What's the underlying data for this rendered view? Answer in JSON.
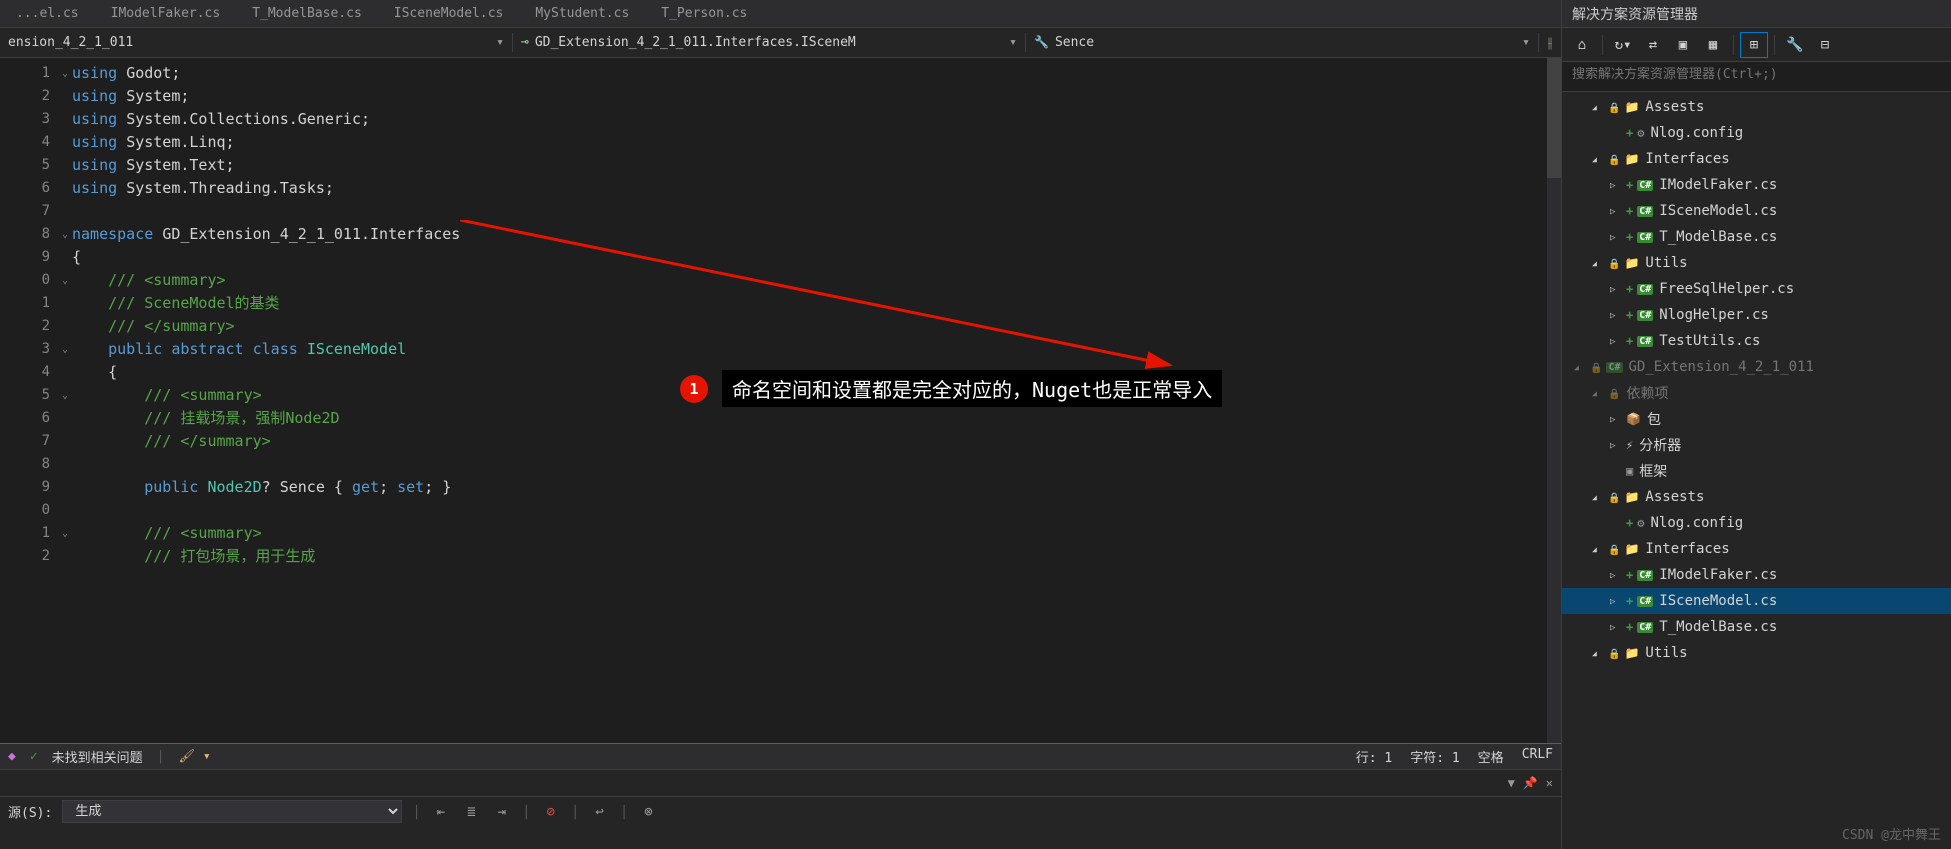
{
  "tabs": [
    {
      "label": "...el.cs"
    },
    {
      "label": "IModelFaker.cs"
    },
    {
      "label": "T_ModelBase.cs"
    },
    {
      "label": "ISceneModel.cs"
    },
    {
      "label": "MyStudent.cs"
    },
    {
      "label": "T_Person.cs"
    }
  ],
  "nav": {
    "project": "ension_4_2_1_011",
    "class": "GD_Extension_4_2_1_011.Interfaces.ISceneM",
    "member": "Sence"
  },
  "code_lines": [
    {
      "n": "1",
      "fold": "v",
      "html": "<span class='k-using'>using</span> <span class='txt'>Godot;</span>"
    },
    {
      "n": "2",
      "fold": "",
      "html": "<span class='k-using'>using</span> <span class='txt'>System;</span>"
    },
    {
      "n": "3",
      "fold": "",
      "html": "<span class='k-using'>using</span> <span class='txt'>System.Collections.Generic;</span>"
    },
    {
      "n": "4",
      "fold": "",
      "html": "<span class='k-using'>using</span> <span class='txt'>System.Linq;</span>"
    },
    {
      "n": "5",
      "fold": "",
      "html": "<span class='k-using'>using</span> <span class='txt'>System.Text;</span>"
    },
    {
      "n": "6",
      "fold": "",
      "html": "<span class='k-using'>using</span> <span class='txt'>System.Threading.Tasks;</span>"
    },
    {
      "n": "7",
      "fold": "",
      "html": ""
    },
    {
      "n": "8",
      "fold": "v",
      "html": "<span class='k-ns'>namespace</span> <span class='txt'>GD_Extension_4_2_1_011.Interfaces</span>"
    },
    {
      "n": "9",
      "fold": "",
      "html": "<span class='txt'>{</span>"
    },
    {
      "n": "0",
      "fold": "v",
      "html": "    <span class='k-comment'>/// &lt;summary&gt;</span>"
    },
    {
      "n": "1",
      "fold": "",
      "html": "    <span class='k-comment'>/// SceneModel的基类</span>"
    },
    {
      "n": "2",
      "fold": "",
      "html": "    <span class='k-comment'>/// &lt;/summary&gt;</span>"
    },
    {
      "n": "3",
      "fold": "v",
      "html": "    <span class='k-mod'>public</span> <span class='k-mod'>abstract</span> <span class='k-mod'>class</span> <span class='k-type'>ISceneModel</span>"
    },
    {
      "n": "4",
      "fold": "",
      "html": "    <span class='txt'>{</span>"
    },
    {
      "n": "5",
      "fold": "v",
      "html": "        <span class='k-comment'>/// &lt;summary&gt;</span>"
    },
    {
      "n": "6",
      "fold": "",
      "html": "        <span class='k-comment'>/// 挂载场景，强制Node2D</span>"
    },
    {
      "n": "7",
      "fold": "",
      "html": "        <span class='k-comment'>/// &lt;/summary&gt;</span>"
    },
    {
      "n": "8",
      "fold": "",
      "html": ""
    },
    {
      "n": "9",
      "fold": "",
      "html": "        <span class='k-mod'>public</span> <span class='k-type'>Node2D</span><span class='txt'>? Sence { </span><span class='k-acc'>get</span><span class='txt'>; </span><span class='k-acc'>set</span><span class='txt'>; }</span>"
    },
    {
      "n": "0",
      "fold": "",
      "html": ""
    },
    {
      "n": "1",
      "fold": "v",
      "html": "        <span class='k-comment'>/// &lt;summary&gt;</span>"
    },
    {
      "n": "2",
      "fold": "",
      "html": "        <span class='k-comment'>/// 打包场景，用于生成</span>"
    }
  ],
  "status": {
    "issues": "未找到相关问题",
    "line": "行: 1",
    "char": "字符: 1",
    "spaces": "空格",
    "crlf": "CRLF"
  },
  "output": {
    "source_label": "源(S):",
    "source_value": "生成"
  },
  "sidebar": {
    "title": "解决方案资源管理器",
    "search_placeholder": "搜索解决方案资源管理器(Ctrl+;)",
    "tree": [
      {
        "depth": 1,
        "arrow": "down",
        "lock": true,
        "icon": "folder",
        "label": "Assests"
      },
      {
        "depth": 2,
        "arrow": "none",
        "plus": true,
        "icon": "cfg",
        "label": "Nlog.config"
      },
      {
        "depth": 1,
        "arrow": "down",
        "lock": true,
        "icon": "folder",
        "label": "Interfaces"
      },
      {
        "depth": 2,
        "arrow": "right",
        "plus": true,
        "icon": "cs",
        "label": "IModelFaker.cs"
      },
      {
        "depth": 2,
        "arrow": "right",
        "plus": true,
        "icon": "cs",
        "label": "ISceneModel.cs"
      },
      {
        "depth": 2,
        "arrow": "right",
        "plus": true,
        "icon": "cs",
        "label": "T_ModelBase.cs"
      },
      {
        "depth": 1,
        "arrow": "down",
        "lock": true,
        "icon": "folder",
        "label": "Utils"
      },
      {
        "depth": 2,
        "arrow": "right",
        "plus": true,
        "icon": "cs",
        "label": "FreeSqlHelper.cs"
      },
      {
        "depth": 2,
        "arrow": "right",
        "plus": true,
        "icon": "cs",
        "label": "NlogHelper.cs"
      },
      {
        "depth": 2,
        "arrow": "right",
        "plus": true,
        "icon": "cs",
        "label": "TestUtils.cs"
      },
      {
        "depth": 0,
        "arrow": "down",
        "lock": true,
        "icon": "cs",
        "label": "GD_Extension_4_2_1_011",
        "dim": true
      },
      {
        "depth": 1,
        "arrow": "down",
        "lock": true,
        "icon": "",
        "label": "依赖项",
        "dim": true
      },
      {
        "depth": 2,
        "arrow": "right",
        "icon": "pkg",
        "label": "包"
      },
      {
        "depth": 2,
        "arrow": "right",
        "icon": "ana",
        "label": "分析器"
      },
      {
        "depth": 2,
        "arrow": "none",
        "icon": "frame",
        "label": "框架"
      },
      {
        "depth": 1,
        "arrow": "down",
        "lock": true,
        "icon": "folder",
        "label": "Assests"
      },
      {
        "depth": 2,
        "arrow": "none",
        "plus": true,
        "icon": "cfg",
        "label": "Nlog.config"
      },
      {
        "depth": 1,
        "arrow": "down",
        "lock": true,
        "icon": "folder",
        "label": "Interfaces"
      },
      {
        "depth": 2,
        "arrow": "right",
        "plus": true,
        "icon": "cs",
        "label": "IModelFaker.cs"
      },
      {
        "depth": 2,
        "arrow": "right",
        "plus": true,
        "icon": "cs",
        "label": "ISceneModel.cs",
        "sel": true
      },
      {
        "depth": 2,
        "arrow": "right",
        "plus": true,
        "icon": "cs",
        "label": "T_ModelBase.cs"
      },
      {
        "depth": 1,
        "arrow": "down",
        "lock": true,
        "icon": "folder",
        "label": "Utils"
      }
    ]
  },
  "annotation": {
    "badge": "1",
    "text": "命名空间和设置都是完全对应的，Nuget也是正常导入"
  },
  "watermark": "CSDN @龙中舞王"
}
